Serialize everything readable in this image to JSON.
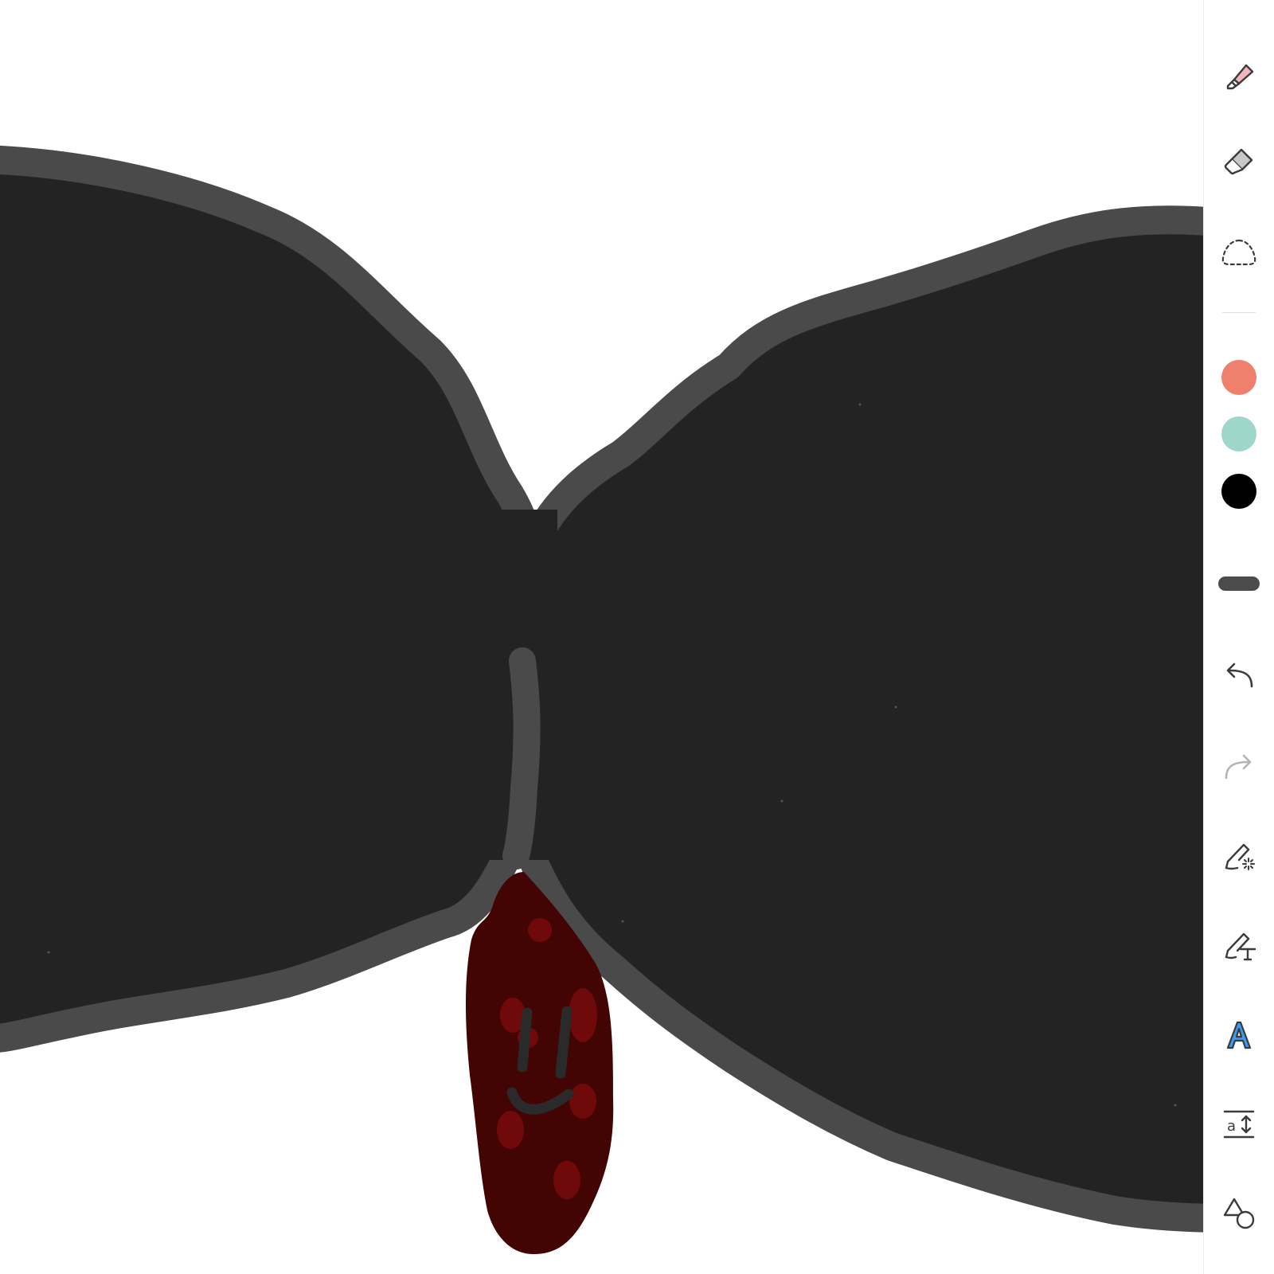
{
  "app": {
    "canvas_background": "#ffffff"
  },
  "drawing": {
    "bow_fill": "#232323",
    "bow_outline": "#4a4a4a",
    "drop_fill": "#430404",
    "drop_spots": "#700a0a",
    "face_stroke": "#2a2a2a"
  },
  "toolbar": {
    "tools": [
      {
        "id": "highlighter",
        "icon": "highlighter-icon"
      },
      {
        "id": "eraser",
        "icon": "eraser-icon"
      },
      {
        "id": "lasso",
        "icon": "lasso-select-icon"
      },
      {
        "id": "color-coral",
        "icon": "color-swatch",
        "color": "#ef806d"
      },
      {
        "id": "color-teal",
        "icon": "color-swatch",
        "color": "#9fd6cc"
      },
      {
        "id": "color-black",
        "icon": "color-swatch",
        "color": "#000000"
      },
      {
        "id": "stroke-width",
        "icon": "stroke-width-icon"
      },
      {
        "id": "undo",
        "icon": "undo-icon"
      },
      {
        "id": "redo",
        "icon": "redo-icon"
      },
      {
        "id": "magic-pen",
        "icon": "magic-pen-icon"
      },
      {
        "id": "text-pen",
        "icon": "handwriting-to-text-icon"
      },
      {
        "id": "text-style",
        "icon": "text-style-icon"
      },
      {
        "id": "spacing",
        "icon": "insert-space-icon"
      },
      {
        "id": "shapes",
        "icon": "shapes-icon"
      }
    ],
    "redo_enabled": false
  }
}
